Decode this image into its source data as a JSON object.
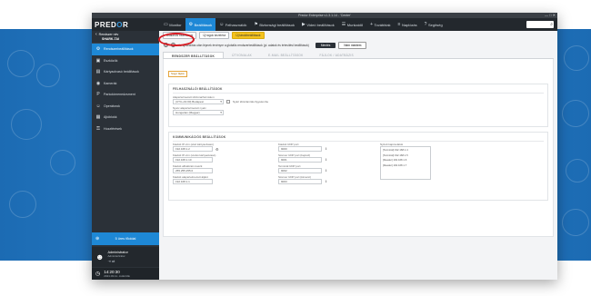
{
  "window": {
    "title": "Predor Enterprise v1.3.1.14 - 'Center'",
    "controls": "—  □  ✕"
  },
  "nav": {
    "logo_a": "PRED",
    "logo_b": "O",
    "logo_c": "R",
    "items": [
      {
        "icon": "monitor-icon",
        "glyph": "▭",
        "label": "Monitor"
      },
      {
        "icon": "gear-icon",
        "glyph": "⚙",
        "label": "Beállítások"
      },
      {
        "icon": "users-icon",
        "glyph": "☺",
        "label": "Felhasználók"
      },
      {
        "icon": "alarm-icon",
        "glyph": "⚑",
        "label": "Biztonsági beállítások"
      },
      {
        "icon": "video-icon",
        "glyph": "▶",
        "label": "Videó beállítások"
      },
      {
        "icon": "tasks-icon",
        "glyph": "☰",
        "label": "Munkaidő"
      },
      {
        "icon": "plus-icon",
        "glyph": "+",
        "label": "Továbbiak"
      },
      {
        "icon": "log-icon",
        "glyph": "≡",
        "label": "Naplózás"
      },
      {
        "icon": "help-icon",
        "glyph": "?",
        "label": "Segítség"
      }
    ],
    "search_glyph": "⌕"
  },
  "sidebar": {
    "header_title": "Rendszer név",
    "header_sub": "SHARK-TAI",
    "items": [
      {
        "label": "Rendszerbeállítások",
        "glyph": "⚙",
        "icon": "settings-icon"
      },
      {
        "label": "Eszközök",
        "glyph": "▣",
        "label_icon": "device",
        "icon": "device-icon"
      },
      {
        "label": "Kártyaolvasó beállítások",
        "glyph": "▤",
        "icon": "card-reader-icon"
      },
      {
        "label": "Kamerák",
        "glyph": "◉",
        "icon": "camera-icon"
      },
      {
        "label": "Parkolómenedzsment",
        "glyph": "P",
        "icon": "parking-icon"
      },
      {
        "label": "Operátorok",
        "glyph": "☺",
        "icon": "operator-icon"
      },
      {
        "label": "Ajtóblokk",
        "glyph": "▦",
        "icon": "door-block-icon"
      },
      {
        "label": "Hozzférések",
        "glyph": "⚿",
        "icon": "access-icon"
      }
    ],
    "lower_label": "5 üres főoldal",
    "lower_glyph": "⊕",
    "user_name": "Administrator",
    "user_role": "Adminisztrátor",
    "user_icons": "⇥ ⇄",
    "time": "14:20:30",
    "date": "2021.03.11. csütörtök"
  },
  "toolbar": {
    "buttons": [
      "Általános beállítások",
      "Új tagok kezelése",
      "Új tárolóbeállítások",
      "Értesítési beállítások"
    ]
  },
  "infobar": {
    "text": "Az újraindítás után lépnek érvényre a globális rendszerbeállítások (pl. adatok és értesítési beállítások)",
    "save": "Mentés",
    "discard": "Nem mentem"
  },
  "tabs": [
    "RENDSZER BEÁLLÍTÁSOK",
    "ÚTVONALAK",
    "E-MAIL BEÁLLÍTÁSOK",
    "FÁJLOK / ADATBÁZIS"
  ],
  "panel": {
    "help_btn": "Súgó fájlok",
    "basic": {
      "title": "FELHASZNÁLÓI BEÁLLÍTÁSOK",
      "label_timezone": "Alapértelmezett időzóna/formátum",
      "timezone_value": "(UTC+01:00) Budapest",
      "checkbox_label": "Nyári időszámítás figyelembe",
      "label_lang": "Nyelv alapértelmezett nyelv",
      "lang_value": "Hungarian (Magyar)"
    },
    "comm": {
      "title": "KOMMUNIKÁCIÓS BEÁLLÍTÁSOK",
      "col1": [
        {
          "label": "Kiadott IP-cím (első kártyaolvasó)",
          "value": "192.168.1.2"
        },
        {
          "label": "Kiadott IP-cím (utolsó kártyaolvasó)",
          "value": "192.168.1.10"
        },
        {
          "label": "Kiadott alhálózati maszk",
          "value": "255.255.255.0"
        },
        {
          "label": "Kiadott alapértelmezett átjáró",
          "value": "192.168.1.1"
        }
      ],
      "col2": [
        {
          "label": "Kiadott UDP port",
          "value": "9000"
        },
        {
          "label": "Szerver UDP port (bejövő)",
          "value": "9001"
        },
        {
          "label": "Terminál UDP port",
          "value": "9002"
        },
        {
          "label": "Szerver UDP port (kimenő)",
          "value": "9003"
        }
      ],
      "col3_label": "Nyitott kapcsolatok",
      "connections": [
        "[Terminál] 192.168.1.4",
        "[Terminál] 192.168.1.5",
        "[Reader] 192.168.1.6",
        "[Reader] 192.168.1.7"
      ]
    }
  }
}
